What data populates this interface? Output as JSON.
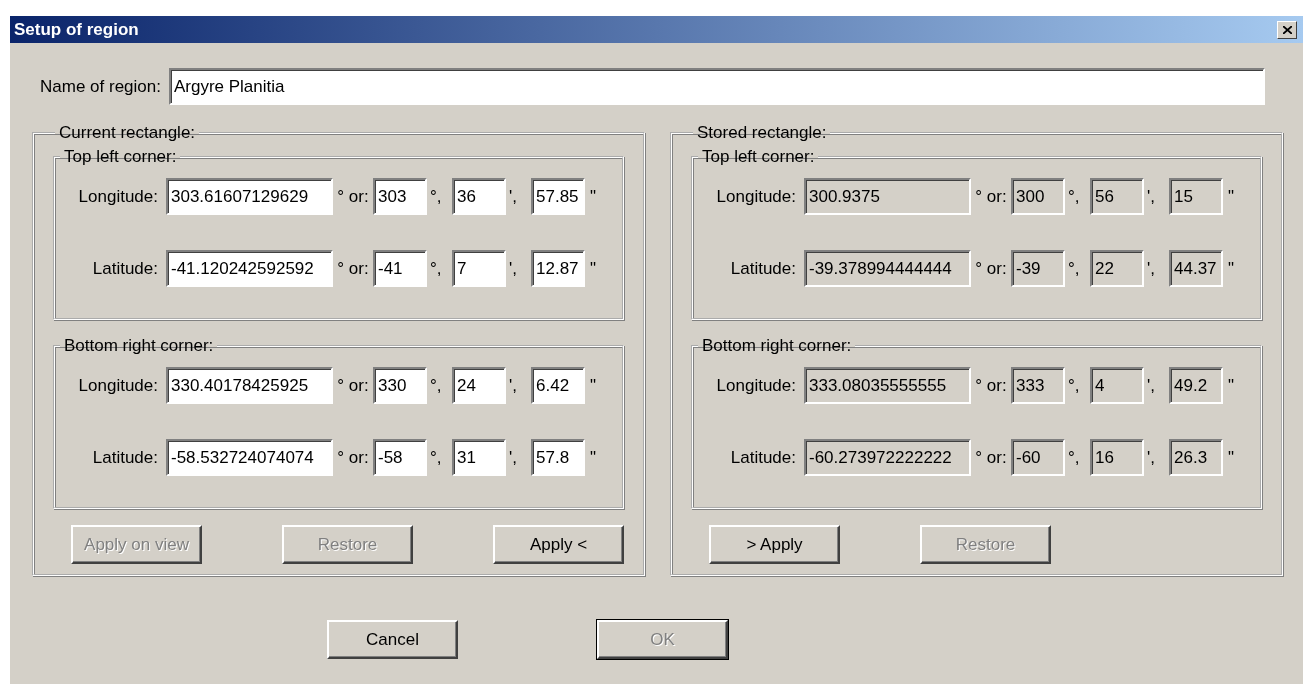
{
  "window": {
    "title": "Setup of region"
  },
  "name_field": {
    "label": "Name of region:",
    "value": "Argyre Planitia"
  },
  "panels": [
    {
      "title": "Current rectangle:",
      "fields_disabled": false,
      "corners": [
        {
          "title": "Top left corner:",
          "rows": [
            {
              "label": "Longitude:",
              "decimal": "303.61607129629",
              "or_label": "° or:",
              "degrees": "303",
              "deg_mark": "°,",
              "minutes": "36",
              "min_mark": "',",
              "seconds": "57.85",
              "sec_mark": "\""
            },
            {
              "label": "Latitude:",
              "decimal": "-41.120242592592",
              "or_label": "° or:",
              "degrees": "-41",
              "deg_mark": "°,",
              "minutes": "7",
              "min_mark": "',",
              "seconds": "12.87",
              "sec_mark": "\""
            }
          ]
        },
        {
          "title": "Bottom right corner:",
          "rows": [
            {
              "label": "Longitude:",
              "decimal": "330.40178425925",
              "or_label": "° or:",
              "degrees": "330",
              "deg_mark": "°,",
              "minutes": "24",
              "min_mark": "',",
              "seconds": "6.42",
              "sec_mark": "\""
            },
            {
              "label": "Latitude:",
              "decimal": "-58.532724074074",
              "or_label": "° or:",
              "degrees": "-58",
              "deg_mark": "°,",
              "minutes": "31",
              "min_mark": "',",
              "seconds": "57.8",
              "sec_mark": "\""
            }
          ]
        }
      ],
      "buttons": [
        {
          "label": "Apply on view",
          "disabled": true
        },
        {
          "label": "Restore",
          "disabled": true
        },
        {
          "label": "Apply <",
          "disabled": false
        }
      ]
    },
    {
      "title": "Stored rectangle:",
      "fields_disabled": true,
      "corners": [
        {
          "title": "Top left corner:",
          "rows": [
            {
              "label": "Longitude:",
              "decimal": "300.9375",
              "or_label": "° or:",
              "degrees": "300",
              "deg_mark": "°,",
              "minutes": "56",
              "min_mark": "',",
              "seconds": "15",
              "sec_mark": "\""
            },
            {
              "label": "Latitude:",
              "decimal": "-39.378994444444",
              "or_label": "° or:",
              "degrees": "-39",
              "deg_mark": "°,",
              "minutes": "22",
              "min_mark": "',",
              "seconds": "44.37",
              "sec_mark": "\""
            }
          ]
        },
        {
          "title": "Bottom right corner:",
          "rows": [
            {
              "label": "Longitude:",
              "decimal": "333.08035555555",
              "or_label": "° or:",
              "degrees": "333",
              "deg_mark": "°,",
              "minutes": "4",
              "min_mark": "',",
              "seconds": "49.2",
              "sec_mark": "\""
            },
            {
              "label": "Latitude:",
              "decimal": "-60.273972222222",
              "or_label": "° or:",
              "degrees": "-60",
              "deg_mark": "°,",
              "minutes": "16",
              "min_mark": "',",
              "seconds": "26.3",
              "sec_mark": "\""
            }
          ]
        }
      ],
      "buttons": [
        {
          "label": "> Apply",
          "disabled": false
        },
        {
          "label": "Restore",
          "disabled": true
        }
      ]
    }
  ],
  "buttons": [
    {
      "label": "Cancel",
      "disabled": false,
      "default": false
    },
    {
      "label": "OK",
      "disabled": true,
      "default": true
    }
  ]
}
